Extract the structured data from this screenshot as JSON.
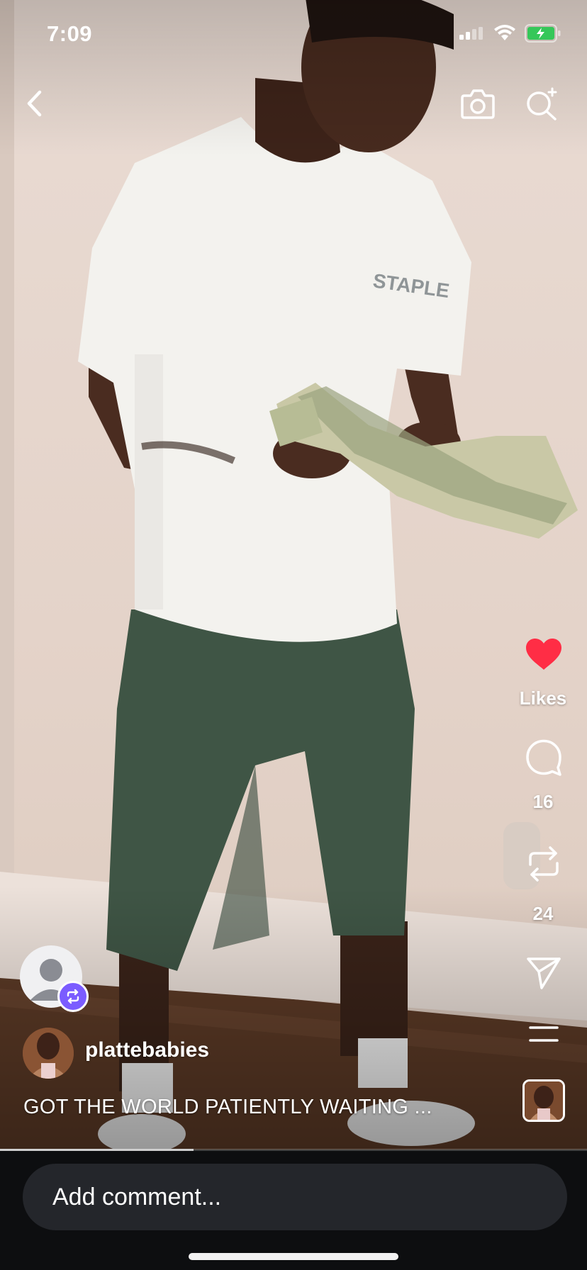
{
  "status_bar": {
    "time": "7:09"
  },
  "rail": {
    "likes_label": "Likes",
    "comments_count": "16",
    "reposts_count": "24"
  },
  "post": {
    "username": "plattebabies",
    "caption": "GOT THE WORLD PATIENTLY WAITING ...",
    "progress_fraction": 0.33
  },
  "comment_bar": {
    "placeholder": "Add comment..."
  },
  "colors": {
    "like_red": "#ff2d45",
    "repost_badge": "#7b5cff"
  },
  "icons": [
    "back-chevron-icon",
    "camera-icon",
    "search-icon",
    "heart-icon",
    "comment-icon",
    "repost-icon",
    "send-icon",
    "menu-icon"
  ]
}
